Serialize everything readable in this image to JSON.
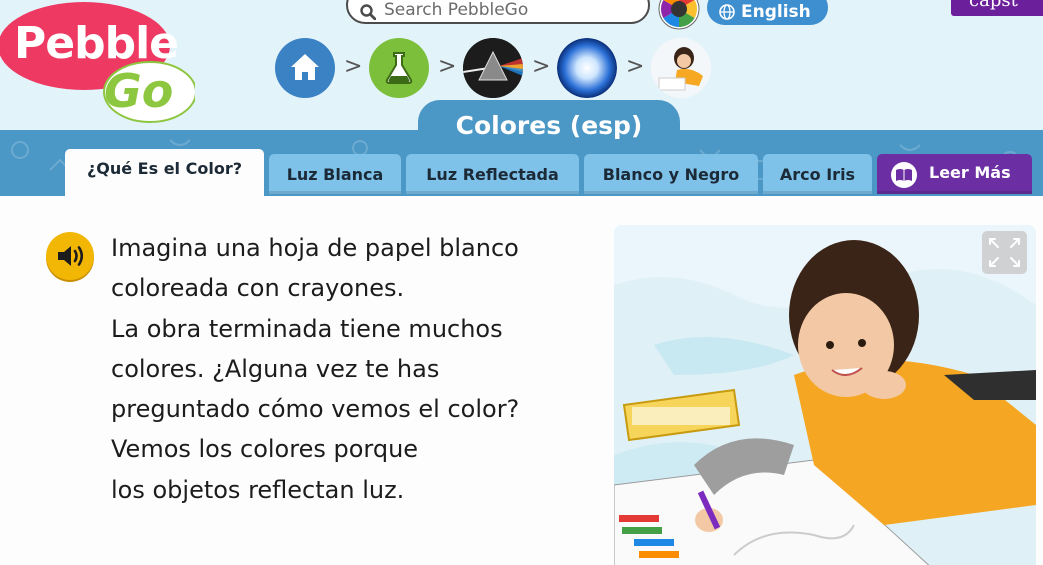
{
  "brand": {
    "line1": "Pebble",
    "line2": "Go"
  },
  "search": {
    "placeholder": "Search PebbleGo"
  },
  "language": {
    "label": "English"
  },
  "partner": {
    "label": "capst"
  },
  "breadcrumbs": [
    {
      "name": "home",
      "icon": "home-icon"
    },
    {
      "name": "science",
      "icon": "flask-icon"
    },
    {
      "name": "light",
      "icon": "prism-icon"
    },
    {
      "name": "color",
      "icon": "light-burst-icon"
    },
    {
      "name": "article",
      "icon": "girl-thumbnail"
    }
  ],
  "breadcrumb_separator": ">",
  "article": {
    "title": "Colores (esp)"
  },
  "tabs": [
    {
      "label": "¿Qué Es el Color?",
      "active": true
    },
    {
      "label": "Luz Blanca",
      "active": false
    },
    {
      "label": "Luz Reflectada",
      "active": false
    },
    {
      "label": "Blanco y Negro",
      "active": false
    },
    {
      "label": "Arco Iris",
      "active": false
    }
  ],
  "read_more": {
    "label": "Leer Más"
  },
  "content": {
    "lines": [
      "Imagina una hoja de papel blanco",
      "coloreada con crayones.",
      "La obra terminada tiene muchos",
      "colores. ¿Alguna vez te has",
      "preguntado cómo vemos el color?",
      "Vemos los colores porque",
      "los objetos reflectan luz."
    ]
  },
  "colors": {
    "header_bg": "#e3f3fa",
    "band": "#4b97c6",
    "tab": "#7ec2ea",
    "read_more": "#6b2fa3",
    "logo_pink": "#ee3a63",
    "logo_green": "#8dc63f",
    "audio": "#f2b705"
  }
}
